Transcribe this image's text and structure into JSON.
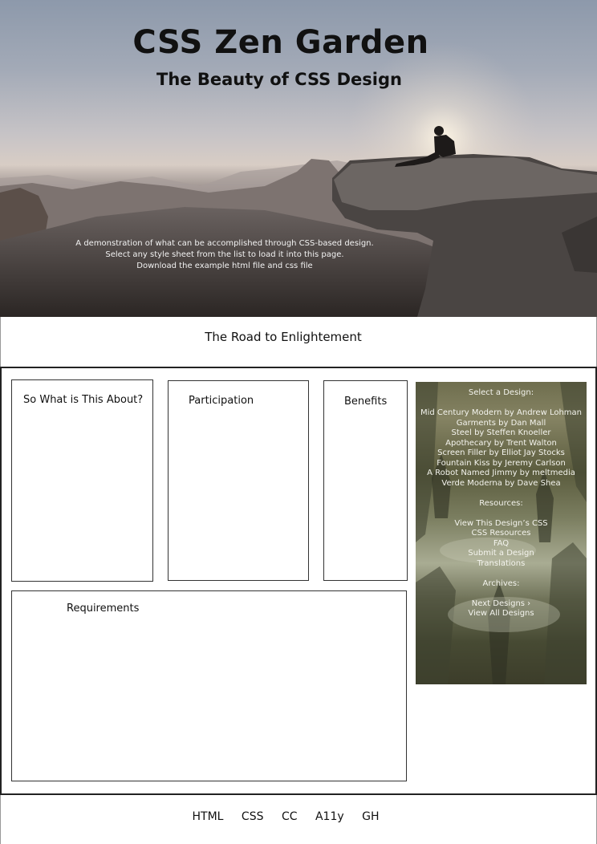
{
  "header": {
    "title": "CSS Zen Garden",
    "subtitle": "The Beauty of CSS Design"
  },
  "intro": {
    "lines": [
      "A demonstration of what can be accomplished through CSS-based design.",
      "Select any style sheet from the list to load it into this page.",
      "Download the example html file and css file"
    ]
  },
  "preamble": {
    "heading": "The Road to Enlightement"
  },
  "main": {
    "sections": {
      "about": "So What is This About?",
      "participation": "Participation",
      "benefits": "Benefits",
      "requirements": "Requirements"
    }
  },
  "sidebar": {
    "select_heading": "Select a Design:",
    "designs": [
      {
        "name": "Mid Century Modern",
        "by": "by",
        "author": "Andrew Lohman"
      },
      {
        "name": "Garments",
        "by": "by",
        "author": "Dan Mall"
      },
      {
        "name": "Steel",
        "by": "by",
        "author": "Steffen Knoeller"
      },
      {
        "name": "Apothecary",
        "by": "by",
        "author": "Trent Walton"
      },
      {
        "name": "Screen Filler",
        "by": "by",
        "author": "Elliot Jay Stocks"
      },
      {
        "name": "Fountain Kiss",
        "by": "by",
        "author": "Jeremy Carlson"
      },
      {
        "name": "A Robot Named Jimmy",
        "by": "by",
        "author": "meltmedia"
      },
      {
        "name": "Verde Moderna",
        "by": "by",
        "author": "Dave Shea"
      }
    ],
    "resources_heading": "Resources:",
    "resources": [
      "View This Design’s CSS",
      "CSS Resources",
      "FAQ",
      "Submit a Design",
      "Translations"
    ],
    "archives_heading": "Archives:",
    "archives": [
      "Next Designs ›",
      "View All Designs"
    ]
  },
  "footer": {
    "links": [
      "HTML",
      "CSS",
      "CC",
      "A11y",
      "GH"
    ]
  }
}
